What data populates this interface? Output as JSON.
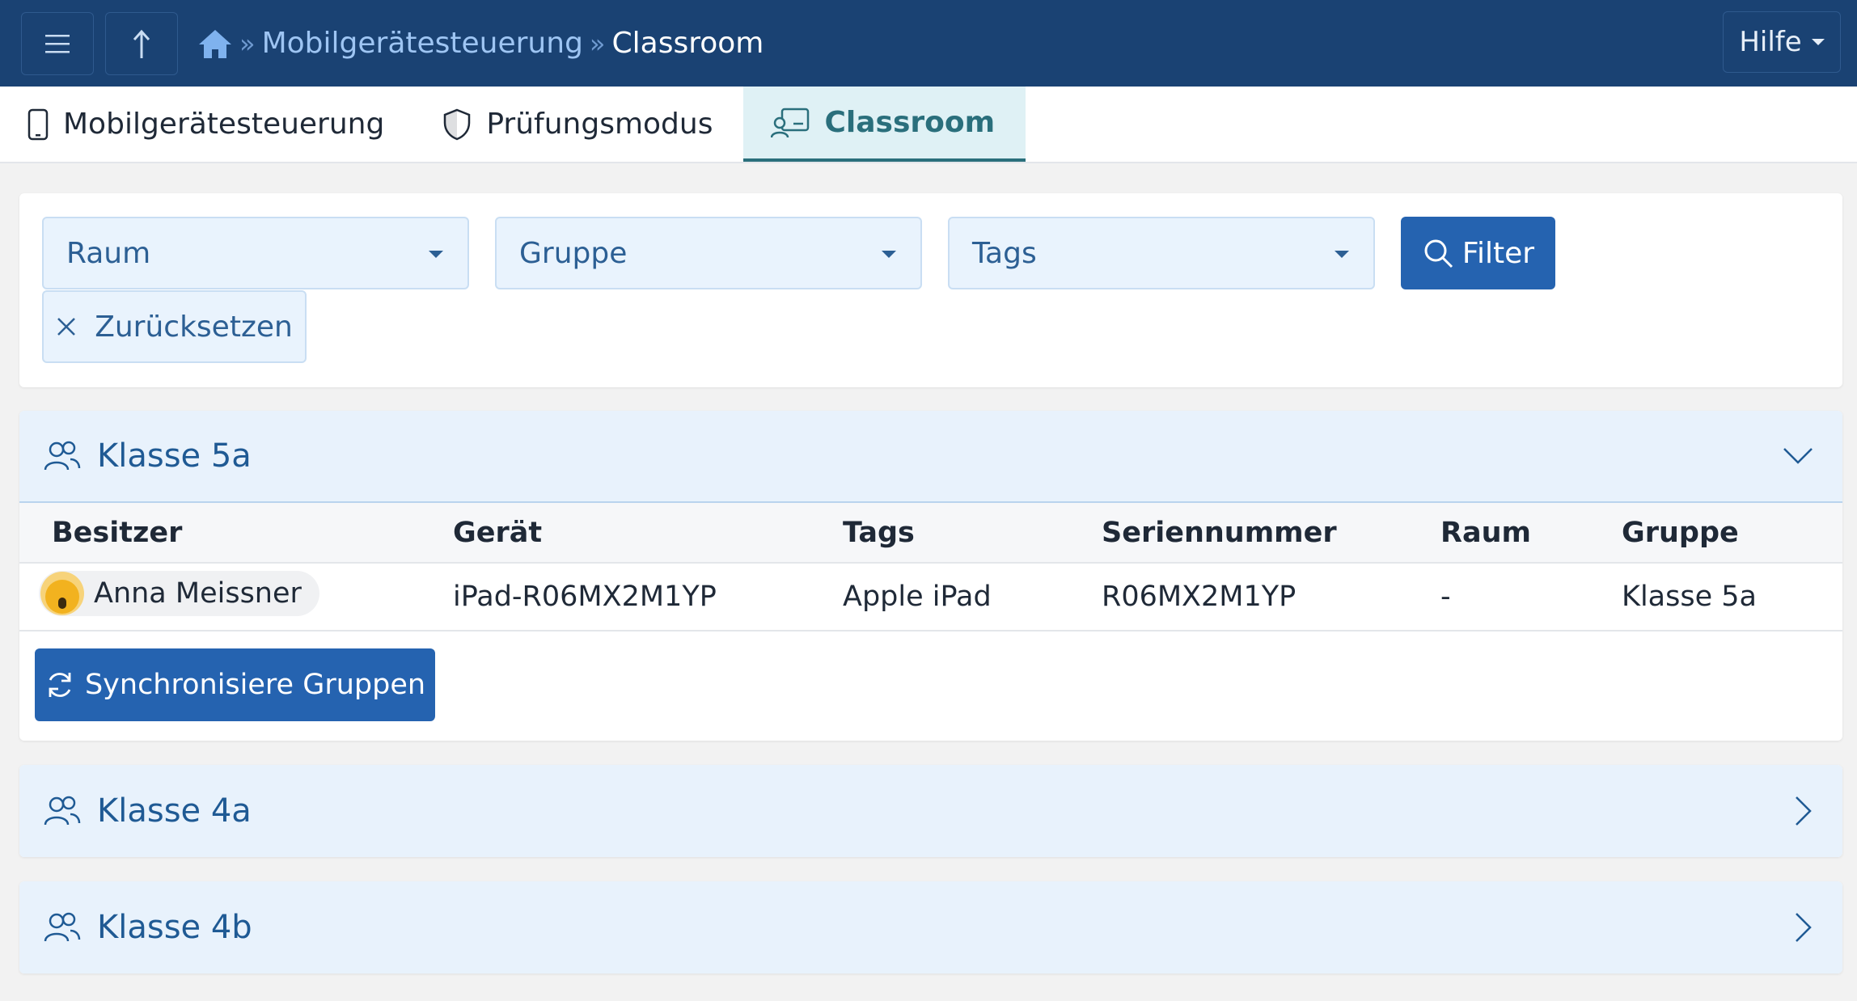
{
  "header": {
    "breadcrumb": {
      "link": "Mobilgerätesteuerung",
      "separator": "»",
      "current": "Classroom"
    },
    "help_label": "Hilfe"
  },
  "tabs": [
    {
      "label": "Mobilgerätesteuerung",
      "icon": "phone-icon",
      "active": false
    },
    {
      "label": "Prüfungsmodus",
      "icon": "shield-icon",
      "active": false
    },
    {
      "label": "Classroom",
      "icon": "classroom-icon",
      "active": true
    }
  ],
  "filters": {
    "room_placeholder": "Raum",
    "group_placeholder": "Gruppe",
    "tags_placeholder": "Tags",
    "filter_label": "Filter",
    "reset_label": "Zurücksetzen"
  },
  "groups": [
    {
      "name": "Klasse 5a",
      "expanded": true,
      "columns": [
        "Besitzer",
        "Gerät",
        "Tags",
        "Seriennummer",
        "Raum",
        "Gruppe"
      ],
      "rows": [
        {
          "owner": "Anna Meissner",
          "device": "iPad-R06MX2M1YP",
          "tags": "Apple iPad",
          "serial": "R06MX2M1YP",
          "room": "-",
          "group": "Klasse 5a"
        }
      ],
      "sync_label": "Synchronisiere Gruppen"
    },
    {
      "name": "Klasse 4a",
      "expanded": false
    },
    {
      "name": "Klasse 4b",
      "expanded": false
    }
  ],
  "colors": {
    "header_bg": "#1a4273",
    "primary": "#2563b0",
    "active_tab": "#2a6f7c",
    "panel_head_bg": "#e8f2fc"
  }
}
